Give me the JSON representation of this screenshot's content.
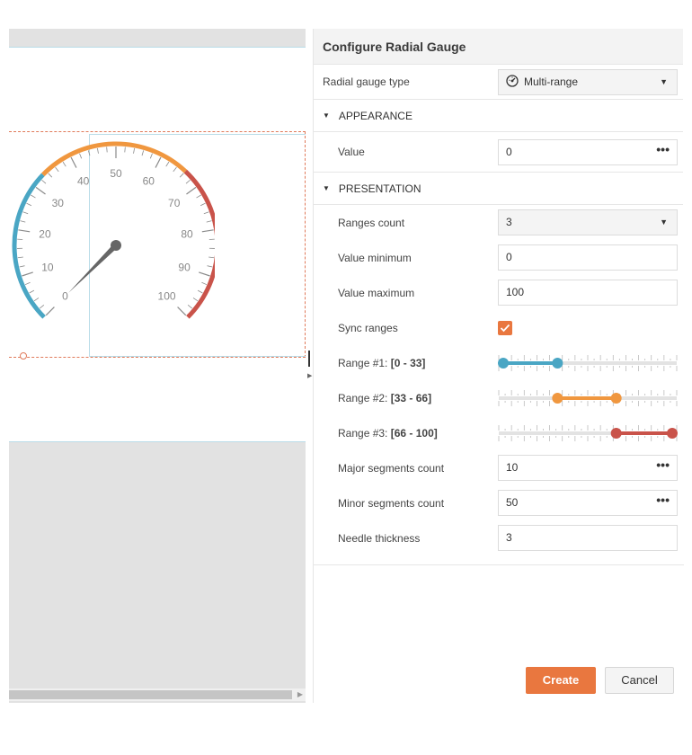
{
  "panel": {
    "title": "Configure Radial Gauge",
    "gauge_type": {
      "label": "Radial gauge type",
      "value": "Multi-range",
      "icon": "gauge-icon"
    },
    "appearance": {
      "header": "APPEARANCE",
      "value_label": "Value",
      "value": "0"
    },
    "presentation": {
      "header": "PRESENTATION",
      "ranges_count_label": "Ranges count",
      "ranges_count": "3",
      "min_label": "Value minimum",
      "min": "0",
      "max_label": "Value maximum",
      "max": "100",
      "sync_label": "Sync ranges",
      "sync": true,
      "ranges": [
        {
          "label": "Range #1:",
          "bracket": "[0 - 33]",
          "from": 0,
          "to": 33,
          "color": "#4aa6c4"
        },
        {
          "label": "Range #2:",
          "bracket": "[33 - 66]",
          "from": 33,
          "to": 66,
          "color": "#f0973f"
        },
        {
          "label": "Range #3:",
          "bracket": "[66 - 100]",
          "from": 66,
          "to": 100,
          "color": "#c9534a"
        }
      ],
      "major_label": "Major segments count",
      "major": "10",
      "minor_label": "Minor segments count",
      "minor": "50",
      "needle_label": "Needle thickness",
      "needle": "3"
    },
    "buttons": {
      "create": "Create",
      "cancel": "Cancel"
    },
    "more_glyph": "•••",
    "caret_glyph": "▼",
    "section_glyph": "▼"
  },
  "gauge": {
    "min": 0,
    "max": 100,
    "value": 0,
    "major_labels": [
      "0",
      "10",
      "20",
      "30",
      "40",
      "50",
      "60",
      "70",
      "80",
      "90",
      "100"
    ],
    "colors": {
      "range1": "#4aa6c4",
      "range2": "#f0973f",
      "range3": "#c9534a",
      "needle": "#666666",
      "ticks": "#8a8a8a"
    }
  },
  "colors": {
    "accent": "#e9773f"
  }
}
